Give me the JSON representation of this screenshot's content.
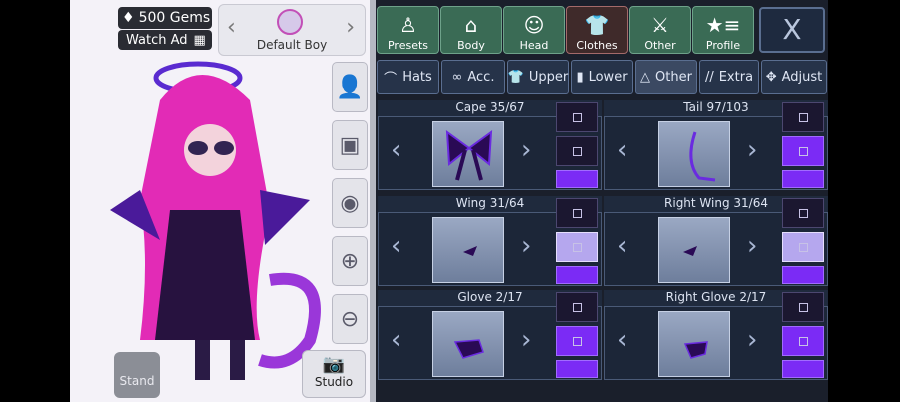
{
  "hud": {
    "gems_label": "500 Gems",
    "watch_ad_label": "Watch Ad"
  },
  "character": {
    "name": "Default Boy"
  },
  "bottom": {
    "stand_label": "Stand",
    "studio_label": "Studio"
  },
  "top_tabs": [
    {
      "label": "Presets",
      "icon": "mannequin-icon"
    },
    {
      "label": "Body",
      "icon": "shirt-body-icon"
    },
    {
      "label": "Head",
      "icon": "head-icon"
    },
    {
      "label": "Clothes",
      "icon": "tshirt-icon"
    },
    {
      "label": "Other",
      "icon": "sword-cat-icon"
    },
    {
      "label": "Profile",
      "icon": "star-list-icon"
    }
  ],
  "close_label": "X",
  "sub_tabs": [
    {
      "label": "Hats"
    },
    {
      "label": "Acc."
    },
    {
      "label": "Upper"
    },
    {
      "label": "Lower"
    },
    {
      "label": "Other"
    },
    {
      "label": "Extra"
    },
    {
      "label": "Adjust"
    }
  ],
  "slots": [
    {
      "title": "Cape 35/67"
    },
    {
      "title": "Tail 97/103"
    },
    {
      "title": "Wing 31/64"
    },
    {
      "title": "Right Wing 31/64"
    },
    {
      "title": "Glove 2/17"
    },
    {
      "title": "Right Glove 2/17"
    }
  ],
  "colors": {
    "accent_purple": "#7b2bf5",
    "panel_bg": "#1a1f2b",
    "tab_green": "#3a6b55"
  }
}
